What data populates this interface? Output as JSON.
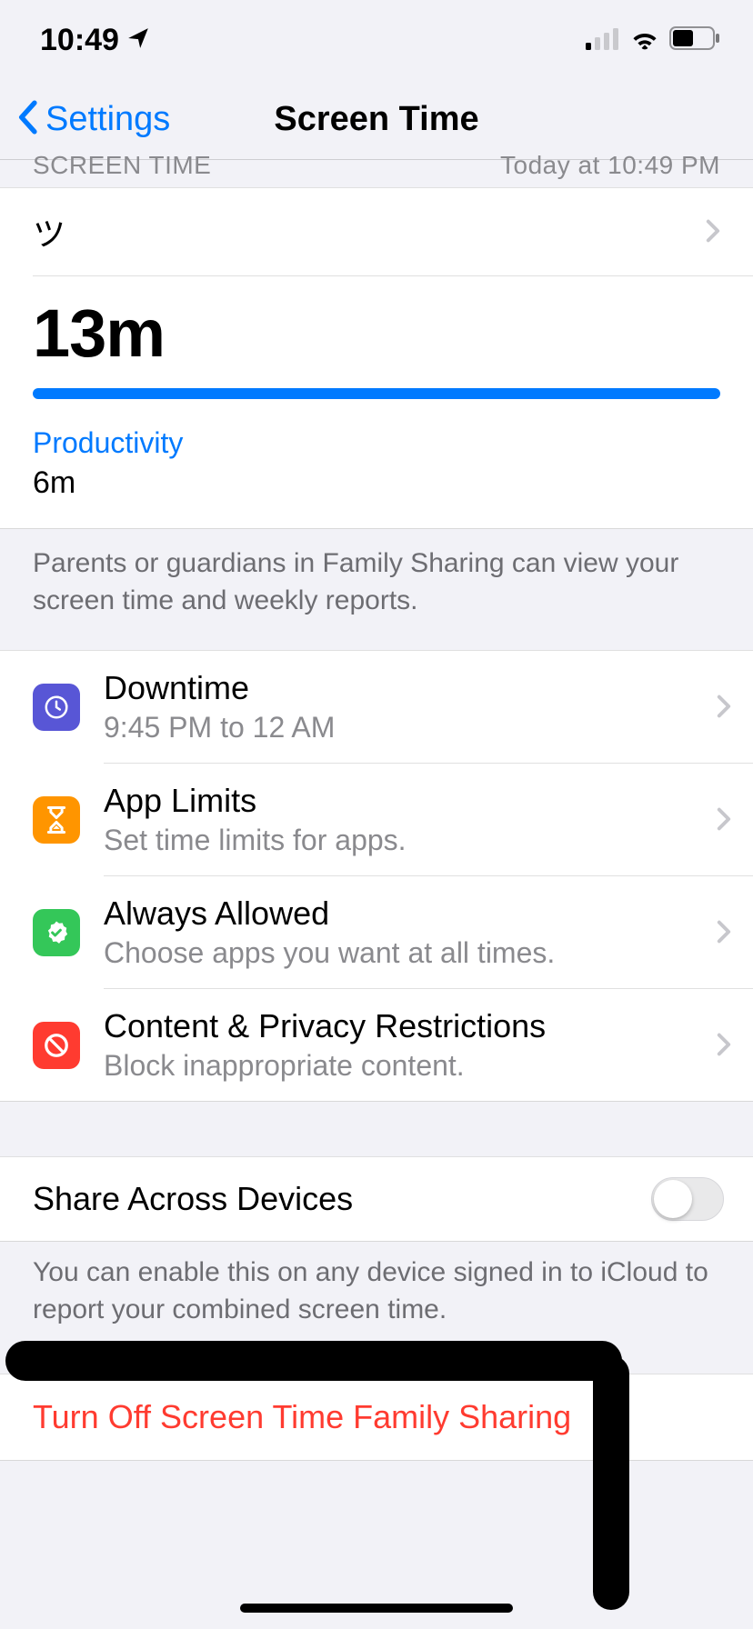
{
  "status": {
    "time": "10:49"
  },
  "nav": {
    "back_label": "Settings",
    "title": "Screen Time"
  },
  "summary": {
    "header_left": "SCREEN TIME",
    "header_right": "Today at 10:49 PM",
    "device_name": "ツ",
    "total_time": "13m",
    "category_label": "Productivity",
    "category_time": "6m"
  },
  "family_note": "Parents or guardians in Family Sharing can view your screen time and weekly reports.",
  "rows": {
    "downtime": {
      "title": "Downtime",
      "subtitle": "9:45 PM to 12 AM"
    },
    "limits": {
      "title": "App Limits",
      "subtitle": "Set time limits for apps."
    },
    "allowed": {
      "title": "Always Allowed",
      "subtitle": "Choose apps you want at all times."
    },
    "content": {
      "title": "Content & Privacy Restrictions",
      "subtitle": "Block inappropriate content."
    }
  },
  "share": {
    "label": "Share Across Devices",
    "note": "You can enable this on any device signed in to iCloud to report your combined screen time.",
    "enabled": false
  },
  "turn_off_label": "Turn Off Screen Time Family Sharing"
}
